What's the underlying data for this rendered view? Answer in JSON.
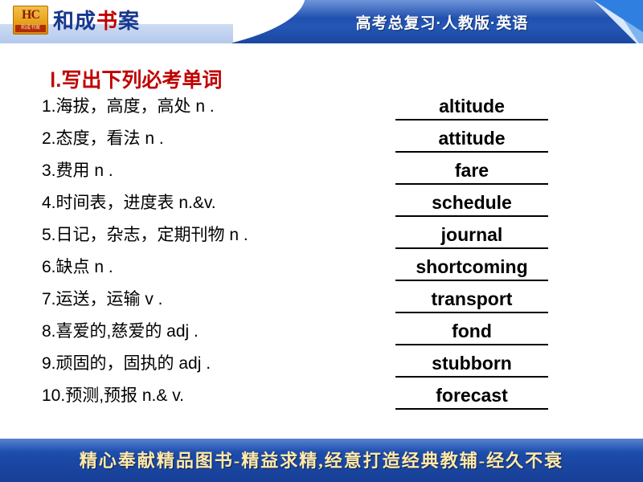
{
  "header": {
    "logo_top": "和成",
    "logo_red": "书",
    "logo_tail": "案",
    "logo_mark_top": "HC",
    "logo_mark_bottom": "和成书案",
    "title": "高考总复习·人教版·英语"
  },
  "main": {
    "section_title": "Ⅰ.写出下列必考单词",
    "items": [
      {
        "prompt": "1.海拔，高度，高处   n  .",
        "answer": "altitude"
      },
      {
        "prompt": "2.态度，看法   n  .",
        "answer": "attitude"
      },
      {
        "prompt": "3.费用   n  .",
        "answer": "fare"
      },
      {
        "prompt": "4.时间表，进度表   n.&v.",
        "answer": "schedule"
      },
      {
        "prompt": "5.日记，杂志，定期刊物   n  .",
        "answer": "journal"
      },
      {
        "prompt": "6.缺点   n   .",
        "answer": "shortcoming"
      },
      {
        "prompt": "7.运送，运输   v   .",
        "answer": "transport"
      },
      {
        "prompt": "8.喜爱的,慈爱的    adj  .",
        "answer": "fond"
      },
      {
        "prompt": "9.顽固的，固执的    adj  .",
        "answer": "stubborn"
      },
      {
        "prompt": "10.预测,预报    n.& v.",
        "answer": "forecast"
      }
    ]
  },
  "footer": {
    "text": "精心奉献精品图书-精益求精,经意打造经典教辅-经久不衰"
  },
  "colors": {
    "header_blue": "#1f4fae",
    "title_red": "#c00000",
    "footer_text": "#ffe9a8"
  }
}
